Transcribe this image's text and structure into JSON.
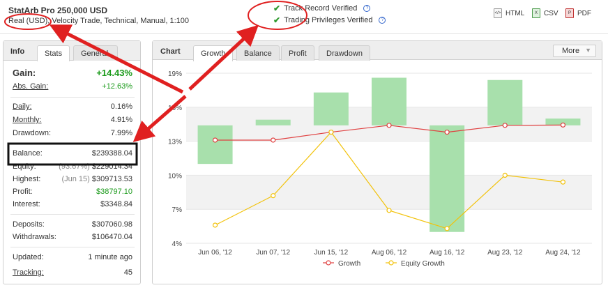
{
  "header": {
    "title": "StatArb Pro 250,000 USD",
    "subtitle": "Real (USD), Velocity Trade, Technical, Manual, 1:100",
    "verified": [
      {
        "label": "Track Record Verified",
        "icon": "check-icon"
      },
      {
        "label": "Trading Privileges Verified",
        "icon": "check-icon"
      }
    ],
    "exports": [
      {
        "label": "HTML",
        "icon": "html-file-icon"
      },
      {
        "label": "CSV",
        "icon": "csv-file-icon"
      },
      {
        "label": "PDF",
        "icon": "pdf-file-icon"
      }
    ]
  },
  "left_panel": {
    "heading": "Info",
    "tabs": [
      "Stats",
      "General"
    ],
    "active_tab": "Stats",
    "gain": {
      "label": "Gain:",
      "value": "+14.43%"
    },
    "abs_gain": {
      "label": "Abs. Gain:",
      "value": "+12.63%"
    },
    "daily": {
      "label": "Daily:",
      "value": "0.16%"
    },
    "monthly": {
      "label": "Monthly:",
      "value": "4.91%"
    },
    "drawdown": {
      "label": "Drawdown:",
      "value": "7.99%"
    },
    "balance": {
      "label": "Balance:",
      "value": "$239388.04"
    },
    "equity": {
      "label": "Equity:",
      "note": "(93.67%)",
      "value": "$229014.34"
    },
    "highest": {
      "label": "Highest:",
      "note": "(Jun 15)",
      "value": "$309713.53"
    },
    "profit": {
      "label": "Profit:",
      "value": "$38797.10"
    },
    "interest": {
      "label": "Interest:",
      "value": "$3348.84"
    },
    "deposits": {
      "label": "Deposits:",
      "value": "$307060.98"
    },
    "withdrawals": {
      "label": "Withdrawals:",
      "value": "$106470.04"
    },
    "updated": {
      "label": "Updated:",
      "value": "1 minute ago"
    },
    "tracking": {
      "label": "Tracking:",
      "value": "45"
    }
  },
  "chart_panel": {
    "heading": "Chart",
    "tabs": [
      "Growth",
      "Balance",
      "Profit",
      "Drawdown"
    ],
    "active_tab": "Growth",
    "more_label": "More",
    "more_icon": "triangle-down-icon"
  },
  "chart_data": {
    "type": "line",
    "title": "",
    "xlabel": "",
    "ylabel": "",
    "categories": [
      "Jun 06, '12",
      "Jun 07, '12",
      "Jun 15, '12",
      "Aug 06, '12",
      "Aug 16, '12",
      "Aug 23, '12",
      "Aug 24, '12"
    ],
    "y_ticks": [
      "19%",
      "16%",
      "13%",
      "10%",
      "7%",
      "4%"
    ],
    "ylim": [
      4,
      19
    ],
    "series": [
      {
        "name": "Growth",
        "type": "line",
        "color": "#e04040",
        "values": [
          13.1,
          13.1,
          13.8,
          14.4,
          13.8,
          14.4,
          14.43
        ]
      },
      {
        "name": "Equity Growth",
        "type": "line",
        "color": "#f2c20a",
        "values": [
          5.6,
          8.2,
          13.8,
          6.9,
          5.3,
          10.0,
          9.4
        ]
      },
      {
        "name": "",
        "type": "bar",
        "color": "#a8e0ac",
        "ranges": [
          [
            11.0,
            14.4
          ],
          [
            14.4,
            14.9
          ],
          [
            14.4,
            17.3
          ],
          [
            14.4,
            18.6
          ],
          [
            5.0,
            14.4
          ],
          [
            14.4,
            18.4
          ],
          [
            14.4,
            15.0
          ]
        ]
      }
    ],
    "legend_position": "bottom",
    "grid": true
  },
  "colors": {
    "gain_green": "#1a9a1a",
    "annotation_red": "#e02020",
    "bar_green": "#a8e0ac"
  }
}
